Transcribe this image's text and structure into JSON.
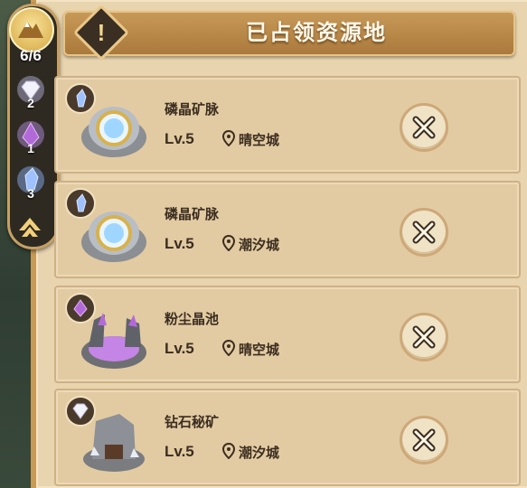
{
  "header": {
    "title": "已占领资源地"
  },
  "side_panel": {
    "count": "6/6",
    "resources": [
      {
        "icon": "diamond-icon",
        "count": "2"
      },
      {
        "icon": "purple-crystal-icon",
        "count": "1"
      },
      {
        "icon": "blue-crystal-icon",
        "count": "3"
      }
    ]
  },
  "rows": [
    {
      "name": "磷晶矿脉",
      "level": "Lv.5",
      "location": "晴空城",
      "badge_icon": "blue-crystal-icon",
      "thumb": "crystal-mine-thumb"
    },
    {
      "name": "磷晶矿脉",
      "level": "Lv.5",
      "location": "潮汐城",
      "badge_icon": "blue-crystal-icon",
      "thumb": "crystal-mine-thumb"
    },
    {
      "name": "粉尘晶池",
      "level": "Lv.5",
      "location": "晴空城",
      "badge_icon": "purple-crystal-icon",
      "thumb": "dust-pool-thumb"
    },
    {
      "name": "钻石秘矿",
      "level": "Lv.5",
      "location": "潮汐城",
      "badge_icon": "diamond-icon",
      "thumb": "diamond-mine-thumb"
    }
  ],
  "colors": {
    "panel_bg": "#e8d4ae",
    "header_bg": "#b7874a",
    "text_dark": "#3b2d20"
  }
}
